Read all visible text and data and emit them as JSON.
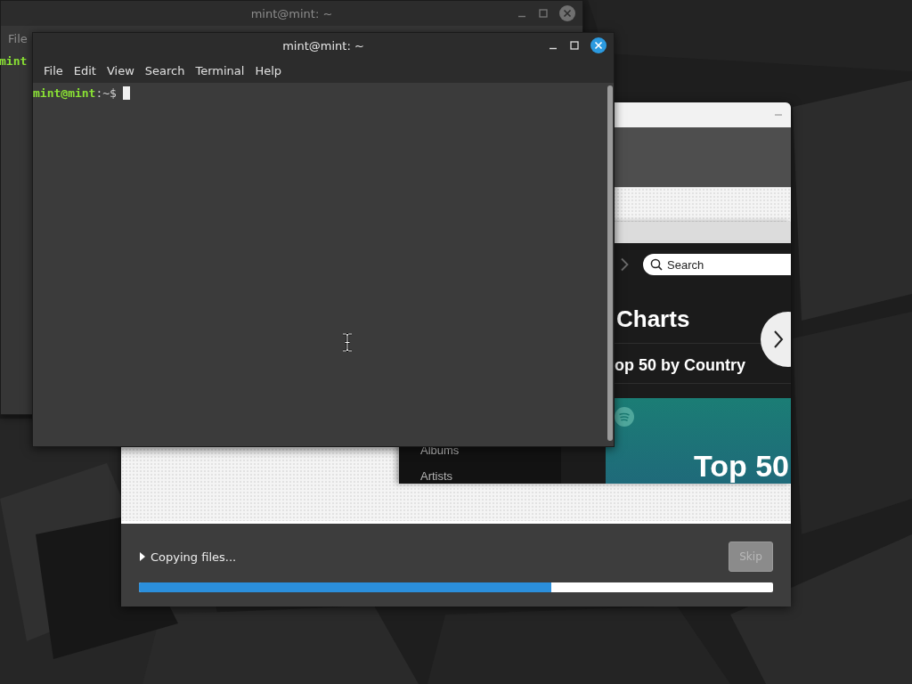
{
  "back_terminal": {
    "title": "mint@mint: ~",
    "menu": [
      "File"
    ],
    "prompt_user": "mint"
  },
  "terminal": {
    "title": "mint@mint: ~",
    "menu": [
      "File",
      "Edit",
      "View",
      "Search",
      "Terminal",
      "Help"
    ],
    "prompt_user": "mint@mint",
    "prompt_path": ":~$"
  },
  "installer": {
    "slideshow": {
      "search_placeholder": "Search",
      "heading": "Charts",
      "subheading": "op 50 by Country",
      "sidebar": [
        "Albums",
        "Artists"
      ],
      "card_title": "Top 50"
    },
    "status": {
      "text": "Copying files...",
      "expanded": false
    },
    "skip_button": {
      "label": "Skip",
      "disabled": true
    },
    "progress": {
      "level": 0.65
    }
  }
}
